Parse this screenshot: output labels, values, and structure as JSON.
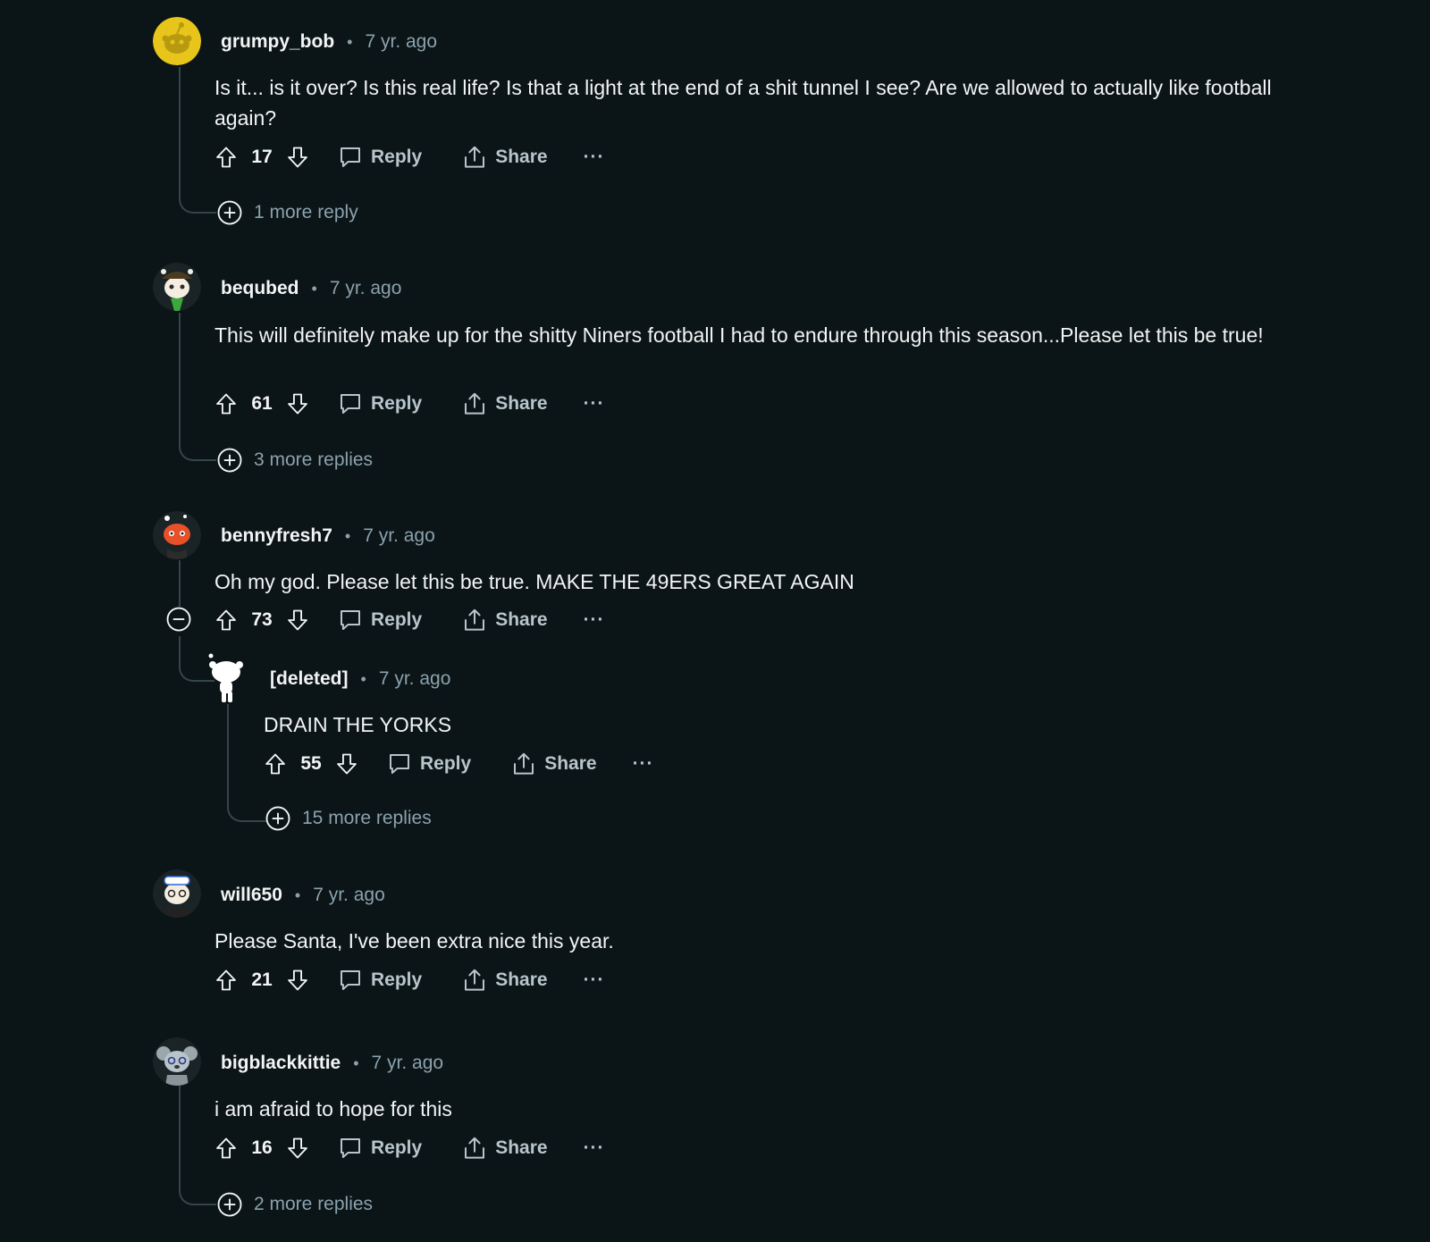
{
  "comments": [
    {
      "username": "grumpy_bob",
      "time": "7 yr. ago",
      "body": "Is it... is it over? Is this real life? Is that a light at the end of a shit tunnel I see? Are we allowed to actually like football again?",
      "score": "17",
      "reply_label": "Reply",
      "share_label": "Share",
      "more_label": "···",
      "more_replies": "1 more reply",
      "avatar_icon": "snoo-yellow-avatar-icon"
    },
    {
      "username": "bequbed",
      "time": "7 yr. ago",
      "body": "This will definitely make up for the shitty Niners football I had to endure through this season...Please let this be true!",
      "score": "61",
      "reply_label": "Reply",
      "share_label": "Share",
      "more_label": "···",
      "more_replies": "3 more replies",
      "avatar_icon": "snoo-hat-avatar-icon"
    },
    {
      "username": "bennyfresh7",
      "time": "7 yr. ago",
      "body": "Oh my god. Please let this be true. MAKE THE 49ERS GREAT AGAIN",
      "score": "73",
      "reply_label": "Reply",
      "share_label": "Share",
      "more_label": "···",
      "avatar_icon": "snoo-orange-avatar-icon",
      "reply": {
        "username": "[deleted]",
        "time": "7 yr. ago",
        "body": "DRAIN THE YORKS",
        "score": "55",
        "reply_label": "Reply",
        "share_label": "Share",
        "more_label": "···",
        "more_replies": "15 more replies",
        "avatar_icon": "snoo-white-avatar-icon"
      }
    },
    {
      "username": "will650",
      "time": "7 yr. ago",
      "body": "Please Santa, I've been extra nice this year.",
      "score": "21",
      "reply_label": "Reply",
      "share_label": "Share",
      "more_label": "···",
      "avatar_icon": "snoo-cap-avatar-icon"
    },
    {
      "username": "bigblackkittie",
      "time": "7 yr. ago",
      "body": "i am afraid to hope for this",
      "score": "16",
      "reply_label": "Reply",
      "share_label": "Share",
      "more_label": "···",
      "more_replies": "2 more replies",
      "avatar_icon": "snoo-koala-avatar-icon"
    }
  ],
  "colors": {
    "background": "#0b1416",
    "text": "#f2f4f5",
    "muted": "#8ba2ad",
    "thread_line": "#33464c"
  }
}
